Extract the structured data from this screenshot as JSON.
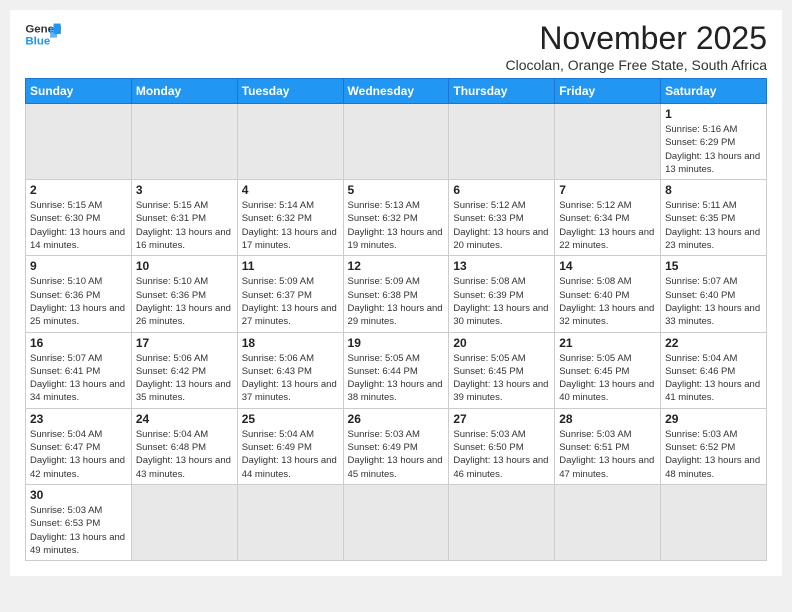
{
  "logo": {
    "line1": "General",
    "line2": "Blue"
  },
  "title": "November 2025",
  "subtitle": "Clocolan, Orange Free State, South Africa",
  "weekdays": [
    "Sunday",
    "Monday",
    "Tuesday",
    "Wednesday",
    "Thursday",
    "Friday",
    "Saturday"
  ],
  "days": [
    {
      "num": "",
      "info": ""
    },
    {
      "num": "",
      "info": ""
    },
    {
      "num": "",
      "info": ""
    },
    {
      "num": "",
      "info": ""
    },
    {
      "num": "",
      "info": ""
    },
    {
      "num": "",
      "info": ""
    },
    {
      "num": "1",
      "sunrise": "5:16 AM",
      "sunset": "6:29 PM",
      "daylight": "13 hours and 13 minutes."
    },
    {
      "num": "2",
      "sunrise": "5:15 AM",
      "sunset": "6:30 PM",
      "daylight": "13 hours and 14 minutes."
    },
    {
      "num": "3",
      "sunrise": "5:15 AM",
      "sunset": "6:31 PM",
      "daylight": "13 hours and 16 minutes."
    },
    {
      "num": "4",
      "sunrise": "5:14 AM",
      "sunset": "6:32 PM",
      "daylight": "13 hours and 17 minutes."
    },
    {
      "num": "5",
      "sunrise": "5:13 AM",
      "sunset": "6:32 PM",
      "daylight": "13 hours and 19 minutes."
    },
    {
      "num": "6",
      "sunrise": "5:12 AM",
      "sunset": "6:33 PM",
      "daylight": "13 hours and 20 minutes."
    },
    {
      "num": "7",
      "sunrise": "5:12 AM",
      "sunset": "6:34 PM",
      "daylight": "13 hours and 22 minutes."
    },
    {
      "num": "8",
      "sunrise": "5:11 AM",
      "sunset": "6:35 PM",
      "daylight": "13 hours and 23 minutes."
    },
    {
      "num": "9",
      "sunrise": "5:10 AM",
      "sunset": "6:36 PM",
      "daylight": "13 hours and 25 minutes."
    },
    {
      "num": "10",
      "sunrise": "5:10 AM",
      "sunset": "6:36 PM",
      "daylight": "13 hours and 26 minutes."
    },
    {
      "num": "11",
      "sunrise": "5:09 AM",
      "sunset": "6:37 PM",
      "daylight": "13 hours and 27 minutes."
    },
    {
      "num": "12",
      "sunrise": "5:09 AM",
      "sunset": "6:38 PM",
      "daylight": "13 hours and 29 minutes."
    },
    {
      "num": "13",
      "sunrise": "5:08 AM",
      "sunset": "6:39 PM",
      "daylight": "13 hours and 30 minutes."
    },
    {
      "num": "14",
      "sunrise": "5:08 AM",
      "sunset": "6:40 PM",
      "daylight": "13 hours and 32 minutes."
    },
    {
      "num": "15",
      "sunrise": "5:07 AM",
      "sunset": "6:40 PM",
      "daylight": "13 hours and 33 minutes."
    },
    {
      "num": "16",
      "sunrise": "5:07 AM",
      "sunset": "6:41 PM",
      "daylight": "13 hours and 34 minutes."
    },
    {
      "num": "17",
      "sunrise": "5:06 AM",
      "sunset": "6:42 PM",
      "daylight": "13 hours and 35 minutes."
    },
    {
      "num": "18",
      "sunrise": "5:06 AM",
      "sunset": "6:43 PM",
      "daylight": "13 hours and 37 minutes."
    },
    {
      "num": "19",
      "sunrise": "5:05 AM",
      "sunset": "6:44 PM",
      "daylight": "13 hours and 38 minutes."
    },
    {
      "num": "20",
      "sunrise": "5:05 AM",
      "sunset": "6:45 PM",
      "daylight": "13 hours and 39 minutes."
    },
    {
      "num": "21",
      "sunrise": "5:05 AM",
      "sunset": "6:45 PM",
      "daylight": "13 hours and 40 minutes."
    },
    {
      "num": "22",
      "sunrise": "5:04 AM",
      "sunset": "6:46 PM",
      "daylight": "13 hours and 41 minutes."
    },
    {
      "num": "23",
      "sunrise": "5:04 AM",
      "sunset": "6:47 PM",
      "daylight": "13 hours and 42 minutes."
    },
    {
      "num": "24",
      "sunrise": "5:04 AM",
      "sunset": "6:48 PM",
      "daylight": "13 hours and 43 minutes."
    },
    {
      "num": "25",
      "sunrise": "5:04 AM",
      "sunset": "6:49 PM",
      "daylight": "13 hours and 44 minutes."
    },
    {
      "num": "26",
      "sunrise": "5:03 AM",
      "sunset": "6:49 PM",
      "daylight": "13 hours and 45 minutes."
    },
    {
      "num": "27",
      "sunrise": "5:03 AM",
      "sunset": "6:50 PM",
      "daylight": "13 hours and 46 minutes."
    },
    {
      "num": "28",
      "sunrise": "5:03 AM",
      "sunset": "6:51 PM",
      "daylight": "13 hours and 47 minutes."
    },
    {
      "num": "29",
      "sunrise": "5:03 AM",
      "sunset": "6:52 PM",
      "daylight": "13 hours and 48 minutes."
    },
    {
      "num": "30",
      "sunrise": "5:03 AM",
      "sunset": "6:53 PM",
      "daylight": "13 hours and 49 minutes."
    },
    {
      "num": "",
      "info": ""
    },
    {
      "num": "",
      "info": ""
    },
    {
      "num": "",
      "info": ""
    },
    {
      "num": "",
      "info": ""
    },
    {
      "num": "",
      "info": ""
    },
    {
      "num": "",
      "info": ""
    }
  ],
  "labels": {
    "sunrise": "Sunrise:",
    "sunset": "Sunset:",
    "daylight": "Daylight:"
  },
  "colors": {
    "header_bg": "#2196f3",
    "accent": "#1976d2"
  }
}
